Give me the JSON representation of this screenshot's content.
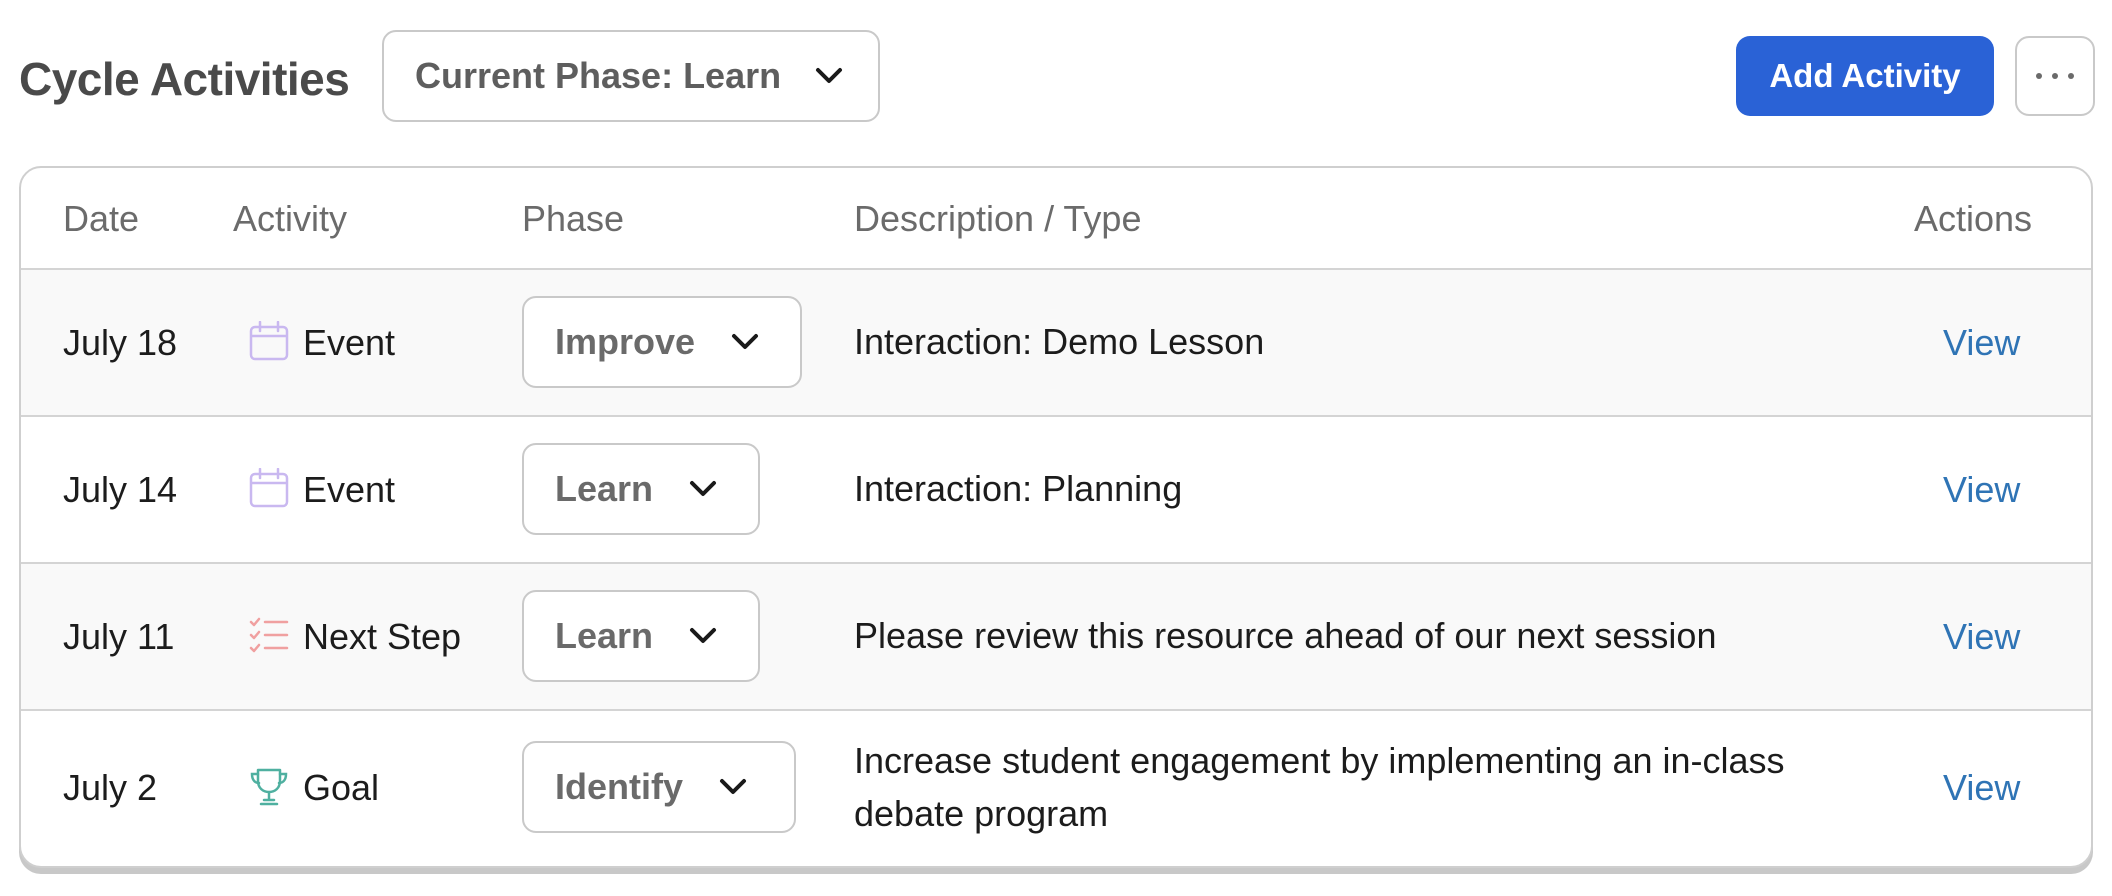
{
  "header": {
    "title": "Cycle Activities",
    "phase_filter": "Current Phase: Learn",
    "add_button": "Add Activity",
    "more_button": "···"
  },
  "table": {
    "columns": [
      "Date",
      "Activity",
      "Phase",
      "Description / Type",
      "Actions"
    ],
    "rows": [
      {
        "date": "July 18",
        "activity": "Event",
        "activity_icon": "calendar-icon",
        "phase": "Improve",
        "description": "Interaction: Demo Lesson",
        "action": "View"
      },
      {
        "date": "July 14",
        "activity": "Event",
        "activity_icon": "calendar-icon",
        "phase": "Learn",
        "description": "Interaction: Planning",
        "action": "View"
      },
      {
        "date": "July 11",
        "activity": "Next Step",
        "activity_icon": "checklist-icon",
        "phase": "Learn",
        "description": "Please review this resource ahead of our next session",
        "action": "View"
      },
      {
        "date": "July 2",
        "activity": "Goal",
        "activity_icon": "trophy-icon",
        "phase": "Identify",
        "description": "Increase student engagement by implementing an in-class debate program",
        "action": "View"
      }
    ]
  },
  "colors": {
    "primary": "#2a62d6",
    "link": "#2f74b5",
    "calendar_icon": "#c9b8f0",
    "checklist_icon": "#f0a0a0",
    "trophy_icon": "#4fb0a0"
  }
}
